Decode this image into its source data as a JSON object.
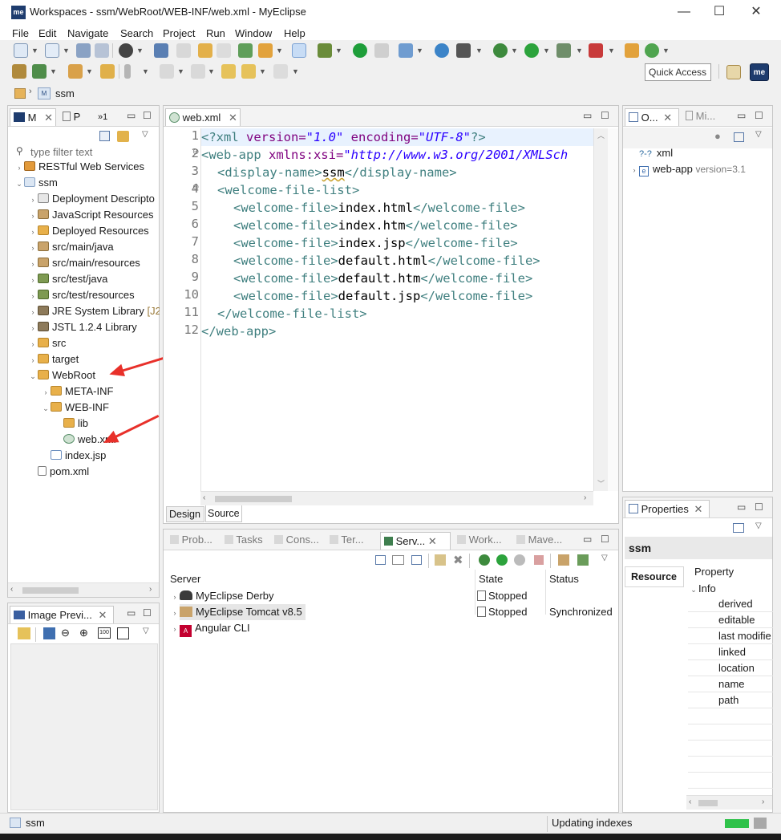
{
  "window": {
    "title": "Workspaces - ssm/WebRoot/WEB-INF/web.xml - MyEclipse",
    "logo_text": "me",
    "minimize": "—",
    "maximize": "☐",
    "close": "✕"
  },
  "menu": [
    "File",
    "Edit",
    "Navigate",
    "Search",
    "Project",
    "Run",
    "Window",
    "Help"
  ],
  "quick_access": "Quick Access",
  "breadcrumb": {
    "item": "ssm"
  },
  "explorer": {
    "tabs": [
      {
        "label": "M"
      },
      {
        "label": "P"
      },
      {
        "label": "»1"
      }
    ],
    "filter_placeholder": "type filter text",
    "items": [
      {
        "label": "RESTful Web Services"
      },
      {
        "label": "ssm"
      },
      {
        "label": "Deployment Descripto"
      },
      {
        "label": "JavaScript Resources"
      },
      {
        "label": "Deployed Resources"
      },
      {
        "label": "src/main/java"
      },
      {
        "label": "src/main/resources"
      },
      {
        "label": "src/test/java"
      },
      {
        "label": "src/test/resources"
      },
      {
        "label": "JRE System Library",
        "suffix": "[J2"
      },
      {
        "label": "JSTL 1.2.4 Library"
      },
      {
        "label": "src"
      },
      {
        "label": "target"
      },
      {
        "label": "WebRoot"
      },
      {
        "label": "META-INF"
      },
      {
        "label": "WEB-INF"
      },
      {
        "label": "lib"
      },
      {
        "label": "web.xml"
      },
      {
        "label": "index.jsp"
      },
      {
        "label": "pom.xml"
      }
    ]
  },
  "editor": {
    "tab_label": "web.xml",
    "line_numbers": [
      "1",
      "2",
      "3",
      "4",
      "5",
      "6",
      "7",
      "8",
      "9",
      "10",
      "11",
      "12"
    ],
    "fold_markers": [
      "⊖",
      "⊖"
    ],
    "xml": {
      "pi_open": "<?xml",
      "version_attr": " version=",
      "version_val": "\"1.0\"",
      "encoding_attr": " encoding=",
      "encoding_val": "\"UTF-8\"",
      "pi_close": "?>",
      "webapp_open": "<web-app",
      "xmlns_attr": " xmlns:xsi=",
      "xmlns_val": "\"http://www.w3.org/2001/XMLSch",
      "display_open": "<display-name>",
      "display_text": "ssm",
      "display_close": "</display-name>",
      "welcome_list_open": "<welcome-file-list>",
      "welcome_open": "<welcome-file>",
      "welcome_close": "</welcome-file>",
      "welcome_files": [
        "index.html",
        "index.htm",
        "index.jsp",
        "default.html",
        "default.htm",
        "default.jsp"
      ],
      "welcome_list_close": "</welcome-file-list>",
      "webapp_close": "</web-app>"
    },
    "bottom_tabs": [
      "Design",
      "Source"
    ]
  },
  "outline": {
    "tabs": [
      {
        "label": "O..."
      },
      {
        "label": "Mi..."
      }
    ],
    "items": [
      {
        "label": "xml",
        "icon": "?-?"
      },
      {
        "label": "web-app",
        "attr": "version=3.1",
        "icon": "e"
      }
    ]
  },
  "properties": {
    "tab_label": "Properties",
    "title": "ssm",
    "side_tab": "Resource",
    "header": "Property",
    "group": "Info",
    "rows": [
      "derived",
      "editable",
      "last modifie",
      "linked",
      "location",
      "name",
      "path"
    ]
  },
  "servers": {
    "tabs": [
      "Prob...",
      "Tasks",
      "Cons...",
      "Ter...",
      "Serv...",
      "Work...",
      "Mave..."
    ],
    "columns": [
      "Server",
      "State",
      "Status"
    ],
    "rows": [
      {
        "name": "MyEclipse Derby",
        "state": "Stopped",
        "status": ""
      },
      {
        "name": "MyEclipse Tomcat v8.5",
        "state": "Stopped",
        "status": "Synchronized"
      },
      {
        "name": "Angular CLI",
        "state": "",
        "status": ""
      }
    ]
  },
  "image_preview": {
    "tab_label": "Image Previ..."
  },
  "statusbar": {
    "selection": "ssm",
    "progress": "Updating indexes"
  },
  "colors": {
    "accent": "#1e3c6e",
    "annotation_arrow": "#e8302a",
    "progress": "#2fc24a"
  }
}
